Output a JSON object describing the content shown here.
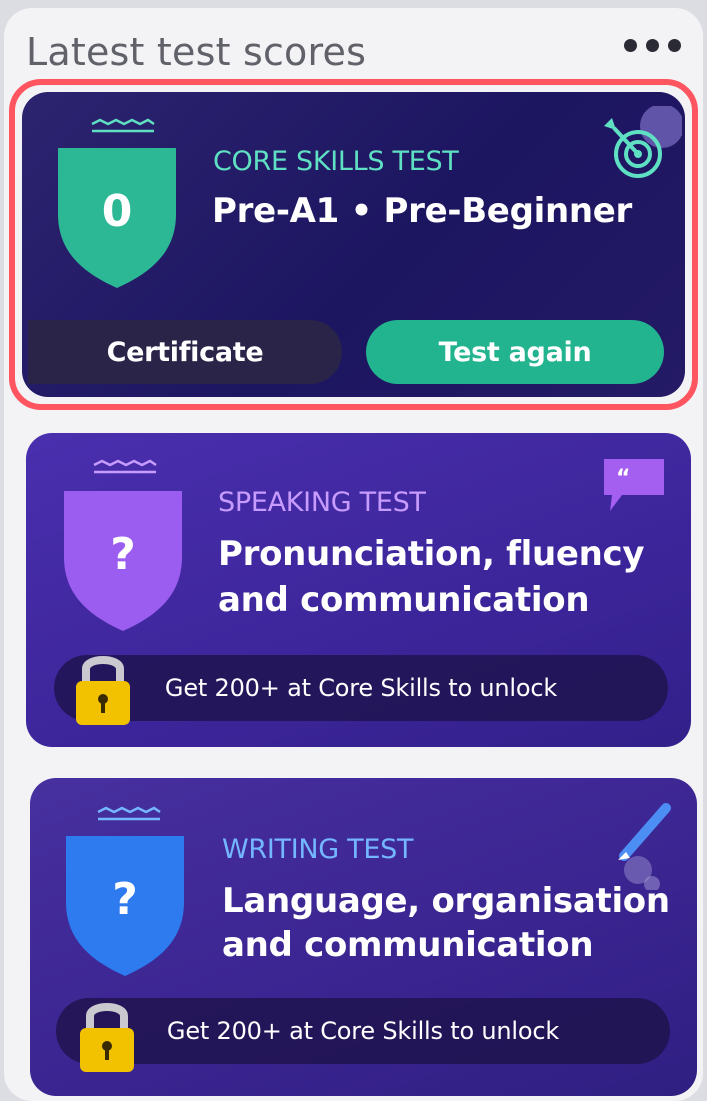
{
  "header": {
    "title": "Latest test scores"
  },
  "cards": {
    "core": {
      "type": "CORE SKILLS TEST",
      "title": "Pre-A1 • Pre-Beginner",
      "score": "0",
      "certificate_label": "Certificate",
      "test_again_label": "Test again",
      "icon": "target-icon"
    },
    "speaking": {
      "type": "SPEAKING TEST",
      "title_line1": "Pronunciation, fluency",
      "title_line2": "and communication",
      "score": "?",
      "lock_text": "Get 200+ at Core Skills to unlock",
      "icon": "speech-bubble-icon"
    },
    "writing": {
      "type": "WRITING TEST",
      "title_line1": "Language, organisation",
      "title_line2": "and communication",
      "score": "?",
      "lock_text": "Get 200+ at Core Skills to unlock",
      "icon": "pen-icon"
    }
  },
  "colors": {
    "core_accent": "#5fe0c3",
    "core_shield": "#2db895",
    "speaking_accent": "#c89bff",
    "speaking_shield": "#9b5cf0",
    "writing_accent": "#74b6ff",
    "writing_shield": "#2e7bf0",
    "test_again_button": "#22b38f",
    "highlight_border": "#ff5560",
    "lock": "#f2c200"
  }
}
